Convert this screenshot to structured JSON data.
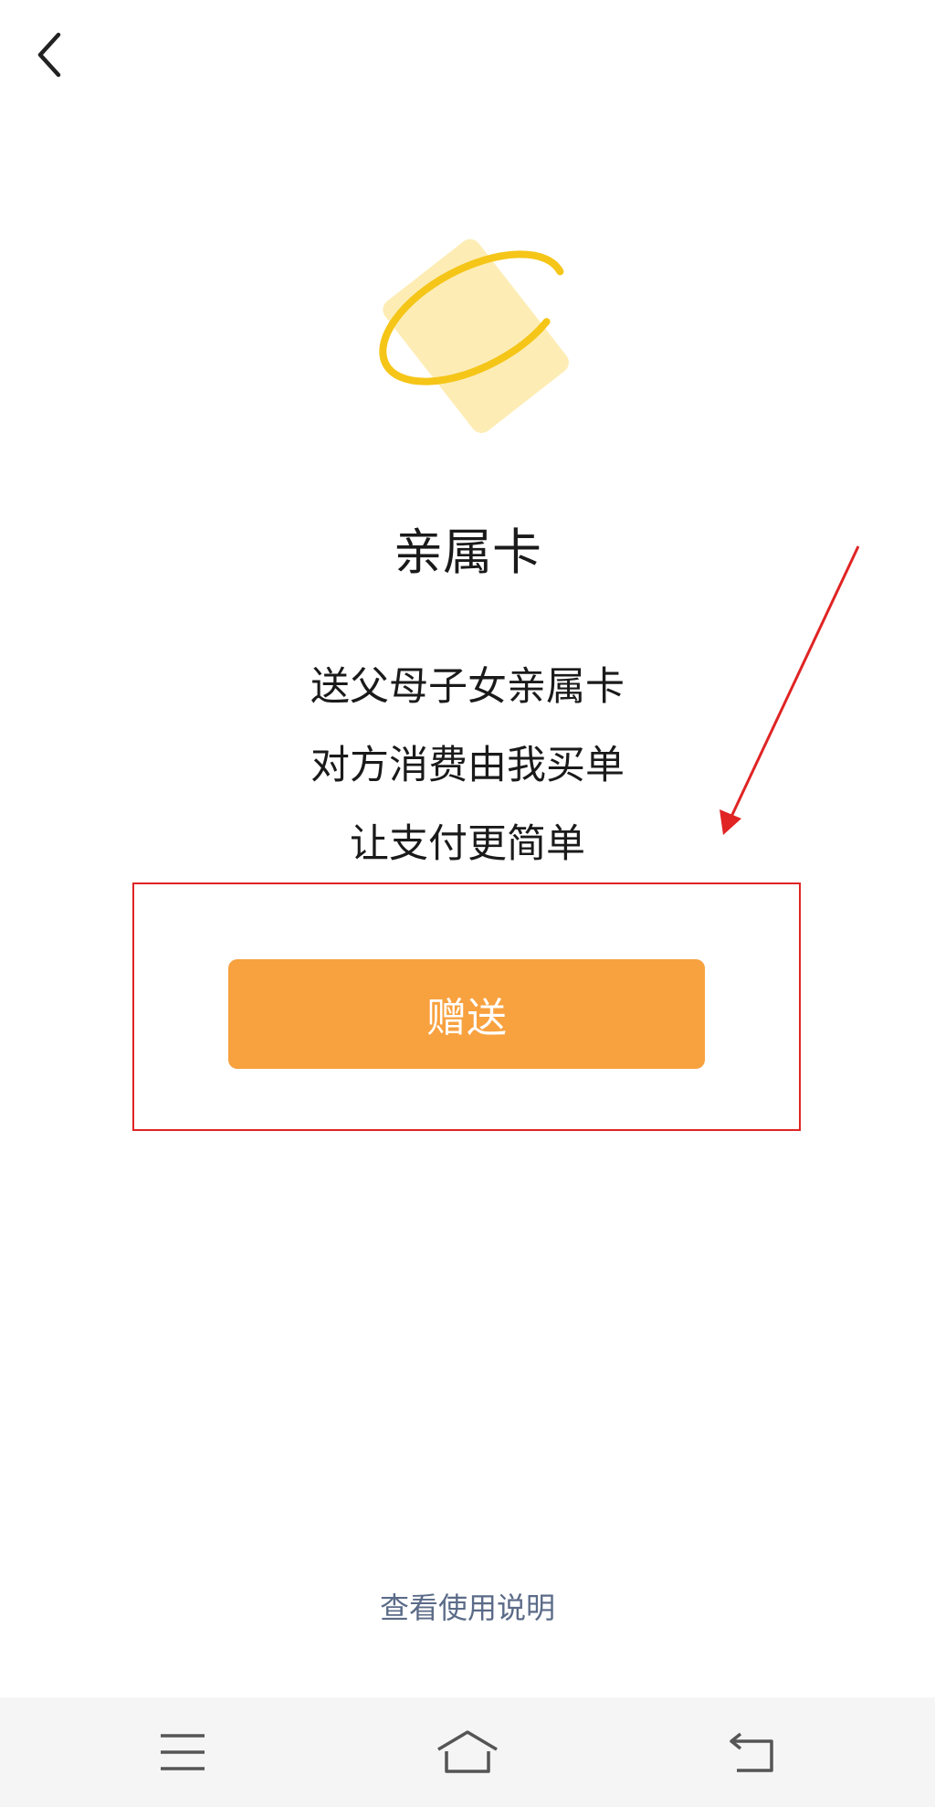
{
  "header": {
    "back_icon": "chevron-left-icon"
  },
  "hero": {
    "icon": "card-orbit-icon",
    "card_color": "#fdedb5",
    "ring_color": "#f5c518"
  },
  "content": {
    "title": "亲属卡",
    "lines": [
      "送父母子女亲属卡",
      "对方消费由我买单",
      "让支付更简单"
    ]
  },
  "action": {
    "gift_label": "赠送",
    "button_color": "#f8a13f"
  },
  "annotation": {
    "color": "#e02424"
  },
  "footer": {
    "help_label": "查看使用说明"
  },
  "system_nav": {
    "menu_icon": "menu-icon",
    "home_icon": "home-icon",
    "back_icon": "return-icon"
  }
}
